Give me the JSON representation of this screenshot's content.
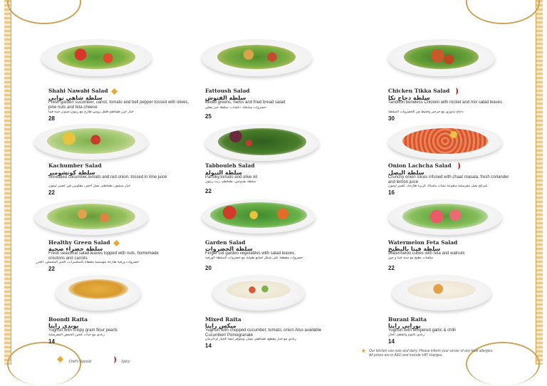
{
  "legend": {
    "chef_special": "Chef's Special",
    "spicy": "Spicy"
  },
  "footer_note": "Our kitchen use nuts and dairy. Please inform your server of any food allergies.\nAll prices are in AED and include VAT charges.",
  "items": [
    {
      "name": "Shahi Nawabi Salad",
      "arabic": "سلطة شاهي نوابي",
      "desc": "Fresh garden cucumber, carrot, tomato and bell pepper tossed with olives, pine nuts and feta cheese",
      "desc_ar": "خيار جزر طماطم فلفل رومي طازج مع زيتون صنوبر جبنة فيتا",
      "price": "28",
      "badge": "chef"
    },
    {
      "name": "Fattoush Salad",
      "arabic": "سلطة الفتوش",
      "desc": "Mixed greens, herbs and fried bread salad",
      "desc_ar": "خضروات مشكلة، أعشاب، سلطة خبز مقلي",
      "price": "25",
      "badge": ""
    },
    {
      "name": "Chicken Tikka Salad",
      "arabic": "سلطة دجاج تكا",
      "desc": "Tandoori boneless Chicken with rocket and mix salad leaves",
      "desc_ar": "دجاج تندوري مع جرجير وخليط من الخضروات السلطة",
      "price": "30",
      "badge": "spicy"
    },
    {
      "name": "Kachumber Salad",
      "arabic": "سلطة كوتشومبر",
      "desc": "Shredded cucumber,tomato and red onion, tossed in lime juice",
      "desc_ar": "خيار مبشور، طماطم، بصل أحمر، مقلوبين في عصير ليمون",
      "price": "22",
      "badge": ""
    },
    {
      "name": "Tabbouleh Salad",
      "arabic": "سلطة التبولة",
      "desc": "Parsley,tomato and olive oil",
      "desc_ar": "سلطة بقدونس، طماطم، زيت زيتون",
      "price": "22",
      "badge": ""
    },
    {
      "name": "Onion Lachcha Salad",
      "arabic": "سلطة البصل",
      "desc": "Crunchy onion slices infused with chaat masala, fresh coriander and lemon juice",
      "desc_ar": "شرائح بصل مقرمشة منقوعة بشات ماسالا، كزبرة طازجة، عصير ليمون",
      "price": "16",
      "badge": "spicy"
    },
    {
      "name": "Healthy Green Salad",
      "arabic": "سلطة خضراء صحية",
      "desc": "Fresh seasonal salad leaves topped with nuts, homemade croutons and carrots",
      "desc_ar": "خضروات ورقية طازجة موسمية مغطاة بالمكسرات، الخبز المحمص، الجزر",
      "price": "22",
      "badge": "chef"
    },
    {
      "name": "Garden Salad",
      "arabic": "سلطة الخضروات",
      "desc": "Finger cut garden vegetables with salad leaves.",
      "desc_ar": "خضروات مقطعة على شكل أصابع طولية مع خضروات السلطة الورقية",
      "price": "20",
      "badge": ""
    },
    {
      "name": "Watermelon Feta Salad",
      "arabic": "سلطة فيتا بالبطيخ",
      "desc": "Watermelon cubes with feta and walnuts",
      "desc_ar": "مكعبات بطيخ مع جبنة فيتا و جوز",
      "price": "22",
      "badge": ""
    },
    {
      "name": "Boondi Raita",
      "arabic": "بوندي رايتا",
      "desc": "Yoghurt with crispy gram flour pearls",
      "desc_ar": "زبادي مع حبات عجين الحمص المقرمشة",
      "price": "14",
      "badge": ""
    },
    {
      "name": "Mixed Raita",
      "arabic": "ميكس رايتا",
      "desc": "Yoghurt with chopped cucumber, tomato, onion Also available Cucumber/ Pomegranate",
      "desc_ar": "زبادي مع خيار مقطع، طماطم، بصل، ومتوفر أيضا الخيار أو الرمان",
      "price": "14",
      "badge": ""
    },
    {
      "name": "Burani Raita",
      "arabic": "بوراني رايتا",
      "desc": "Yoghurt with tempered garlic & chilli",
      "desc_ar": "زبادي بالثوم والفلفل الحار",
      "price": "14",
      "badge": ""
    }
  ]
}
